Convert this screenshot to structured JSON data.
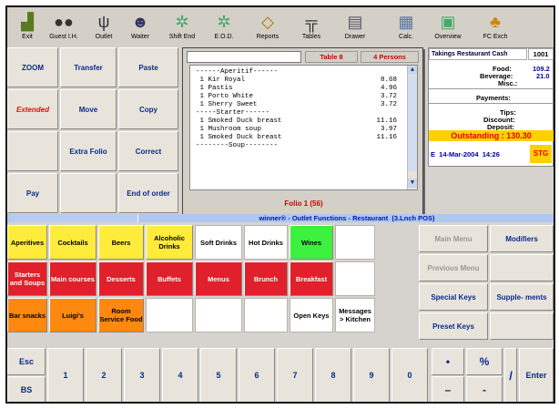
{
  "toolbar": {
    "items": [
      {
        "label": "Exit",
        "icon": "exit-icon",
        "glyph": "🚪"
      },
      {
        "label": "Guest I.H.",
        "icon": "guest-icon",
        "glyph": "👥"
      },
      {
        "label": "Outlet",
        "icon": "outlet-icon",
        "glyph": "🍴"
      },
      {
        "label": "Waiter",
        "icon": "waiter-icon",
        "glyph": "🧑"
      },
      {
        "label": "Shift End",
        "icon": "shift-end-icon",
        "glyph": "⚙"
      },
      {
        "label": "E.O.D.",
        "icon": "eod-icon",
        "glyph": "⚙"
      },
      {
        "label": "Reports",
        "icon": "reports-icon",
        "glyph": "📄"
      },
      {
        "label": "Tables",
        "icon": "tables-icon",
        "glyph": "🪑"
      },
      {
        "label": "Drawer",
        "icon": "drawer-icon",
        "glyph": "🗄"
      },
      {
        "label": "Calc.",
        "icon": "calc-icon",
        "glyph": "🧮"
      },
      {
        "label": "Overview",
        "icon": "overview-icon",
        "glyph": "📋"
      },
      {
        "label": "FC Exch",
        "icon": "fc-exchange-icon",
        "glyph": "💱"
      }
    ]
  },
  "left_buttons": {
    "zoom": "ZOOM",
    "transfer": "Transfer",
    "paste": "Paste",
    "extended": "Extended",
    "move": "Move",
    "copy": "Copy",
    "extra_folio": "Extra Folio",
    "correct": "Correct",
    "pay": "Pay",
    "end_of_order": "End of order"
  },
  "popup": {
    "table": "Table 8",
    "persons": "4 Persons",
    "folio": "Folio 1 (56)",
    "lines": [
      {
        "text": "------Aperitif------",
        "price": ""
      },
      {
        "text": " 1 Kir Royal",
        "price": "8.68"
      },
      {
        "text": " 1 Pastis",
        "price": "4.96"
      },
      {
        "text": " 1 Porto White",
        "price": "3.72"
      },
      {
        "text": " 1 Sherry Sweet",
        "price": "3.72"
      },
      {
        "text": "-----Starter------",
        "price": ""
      },
      {
        "text": " 1 Smoked Duck breast",
        "price": "11.16"
      },
      {
        "text": " 1 Mushroom soup",
        "price": "3.97"
      },
      {
        "text": " 1 Smoked Duck breast",
        "price": "11.16"
      },
      {
        "text": "--------Soup--------",
        "price": ""
      }
    ]
  },
  "takings": {
    "title": "Takings Restaurant Cash",
    "id": "1001",
    "food_label": "Food:",
    "food": "109.2",
    "beverage_label": "Beverage:",
    "beverage": "21.0",
    "misc_label": "Misc.:",
    "payments_label": "Payments:",
    "tips_label": "Tips:",
    "discount_label": "Discount:",
    "deposit_label": "Deposit:",
    "outstanding": "Outstanding : 130.30",
    "date": "E  14-Mar-2004  14:26",
    "stg": "STG"
  },
  "status_bar": "winner® - Outlet Functions - Restaurant  (3.Lnch POS)",
  "categories": {
    "row1": [
      "Aperitives",
      "Cocktails",
      "Beers",
      "Alcoholic Drinks",
      "Soft Drinks",
      "Hot Drinks",
      "Wines"
    ],
    "row2": [
      "Starters and Soups",
      "Main courses",
      "Desserts",
      "Buffets",
      "Menus",
      "Brunch",
      "Breakfast"
    ],
    "row3": [
      "Bar snacks",
      "Luigi's",
      "Room Service Food",
      "Open Keys",
      "Messages > Kitchen"
    ]
  },
  "right_buttons": {
    "main_menu": "Main Menu",
    "modifiers": "Modifiers",
    "previous_menu": "Previous Menu",
    "special_keys": "Special Keys",
    "supplements": "Supple- ments",
    "preset_keys": "Preset Keys"
  },
  "keypad": {
    "esc": "Esc",
    "bs": "BS",
    "digits": [
      "1",
      "2",
      "3",
      "4",
      "5",
      "6",
      "7",
      "8",
      "9",
      "0"
    ],
    "dot": "•",
    "percent": "%",
    "slash": "/",
    "minus": "–",
    "dash2": "-",
    "enter": "Enter"
  }
}
